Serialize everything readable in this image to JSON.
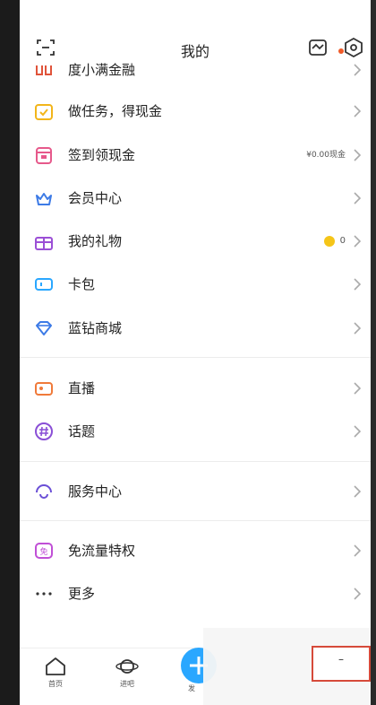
{
  "header": {
    "title": "我的"
  },
  "menu": [
    {
      "label": "度小满金融",
      "extra": ""
    },
    {
      "label": "做任务，得现金",
      "extra": ""
    },
    {
      "label": "签到领现金",
      "extra": "¥0.00现金"
    },
    {
      "label": "会员中心",
      "extra": ""
    },
    {
      "label": "我的礼物",
      "extra": "0"
    },
    {
      "label": "卡包",
      "extra": ""
    },
    {
      "label": "蓝钻商城",
      "extra": ""
    },
    {
      "label": "直播",
      "extra": ""
    },
    {
      "label": "话题",
      "extra": ""
    },
    {
      "label": "服务中心",
      "extra": ""
    },
    {
      "label": "免流量特权",
      "extra": ""
    },
    {
      "label": "更多",
      "extra": ""
    }
  ],
  "bottom_nav": [
    {
      "label": "首页"
    },
    {
      "label": "进吧"
    },
    {
      "label": "发"
    }
  ],
  "colors": {
    "accent_blue": "#2aa7ff",
    "red_dot": "#f05a28",
    "coin": "#f5c518",
    "overlay_border": "#d64a3a"
  },
  "icons": [
    "scan-icon",
    "stats-icon",
    "settings-icon",
    "chevron-right-icon"
  ]
}
